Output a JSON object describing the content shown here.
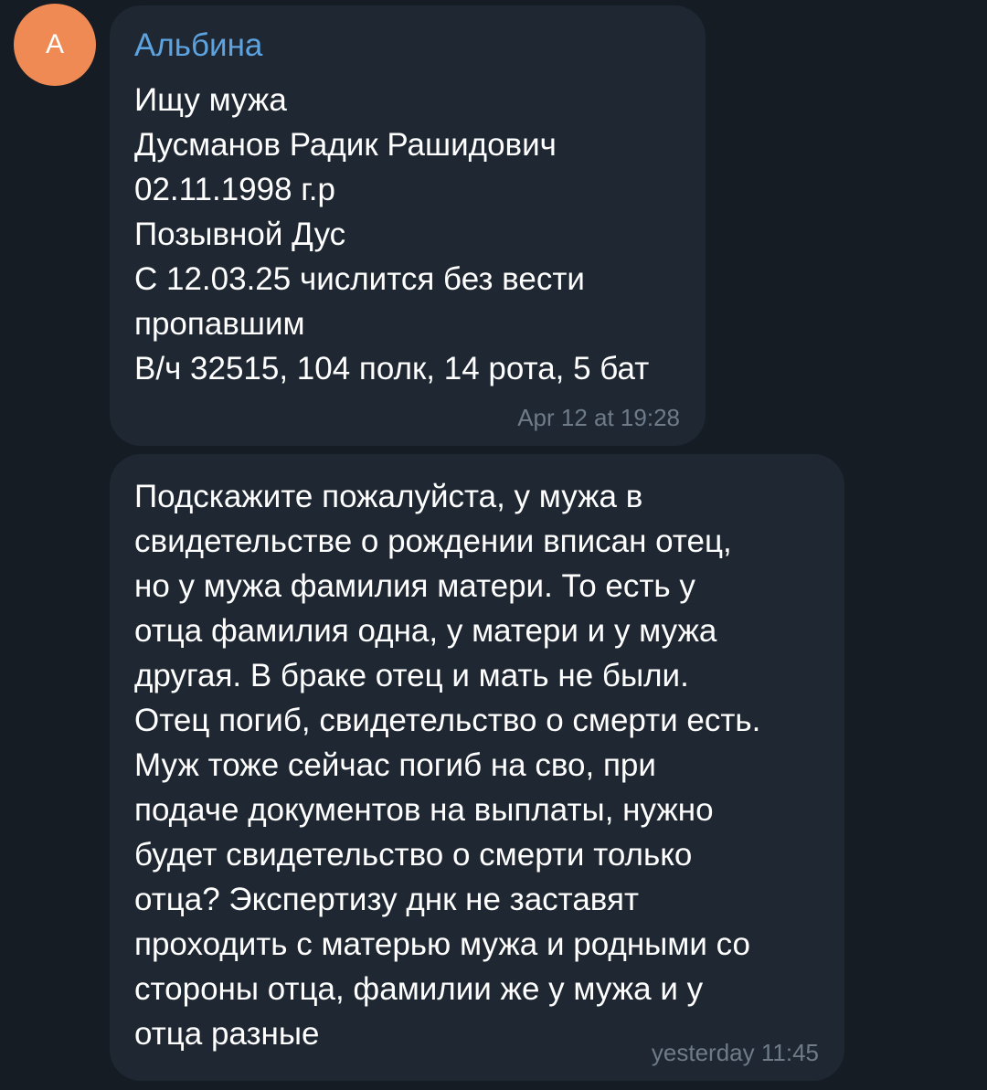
{
  "colors": {
    "background": "#151c24",
    "bubble": "#1e2732",
    "avatar": "#ef8a55",
    "sender_name": "#5da3e0",
    "timestamp": "#6f7b89",
    "text": "#ffffff"
  },
  "messages": [
    {
      "avatar_letter": "А",
      "sender": "Альбина",
      "lines": [
        "Ищу мужа",
        "Дусманов Радик Рашидович",
        "02.11.1998 г.р",
        "Позывной Дус",
        "С 12.03.25 числится без вести",
        "пропавшим",
        "В/ч 32515, 104 полк, 14 рота, 5 бат"
      ],
      "time": "Apr 12 at 19:28"
    },
    {
      "lines": [
        "Подскажите пожалуйста, у мужа в",
        "свидетельстве о рождении вписан отец,",
        "но у мужа фамилия матери. То есть у",
        "отца фамилия одна, у матери и у мужа",
        "другая. В браке отец и мать не были.",
        "Отец погиб, свидетельство о смерти есть.",
        "Муж тоже сейчас погиб на сво, при",
        "подаче документов на выплаты, нужно",
        "будет свидетельство о смерти только",
        "отца? Экспертизу днк не заставят",
        "проходить с матерью мужа и родными со",
        "стороны отца, фамилии же у мужа и у",
        "отца разные"
      ],
      "time": "yesterday 11:45"
    }
  ]
}
